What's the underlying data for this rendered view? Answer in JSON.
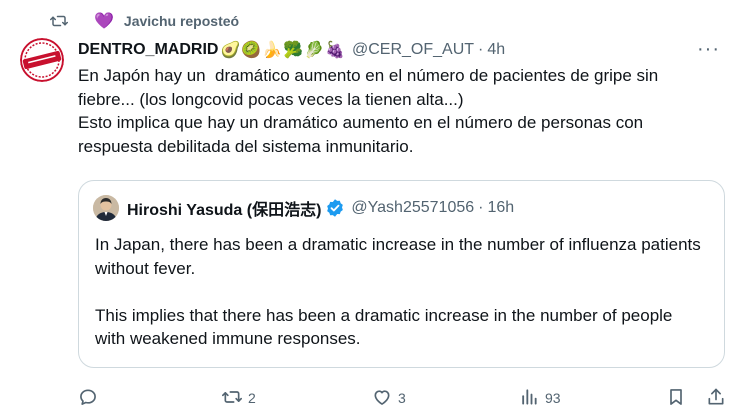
{
  "repost": {
    "text": "Javichu reposteó",
    "icon": "repost-icon",
    "heart_color": "#b58cf0"
  },
  "tweet": {
    "author_name": "DENTRO_MADRID",
    "author_emojis": "🥑🥝🍌🥦🥬🍇",
    "handle": "@CER_OF_AUT",
    "dot": "·",
    "time": "4h",
    "text": "En Japón hay un  dramático aumento en el número de pacientes de gripe sin fiebre... (los longcovid pocas veces la tienen alta...)\nEsto implica que hay un dramático aumento en el número de personas con respuesta debilitada del sistema inmunitario.",
    "more_label": "···"
  },
  "quote": {
    "name": "Hiroshi Yasuda (保田浩志)",
    "handle": "@Yash25571056",
    "dot": "·",
    "time": "16h",
    "verified_color": "#1d9bf0",
    "text": "In Japan, there has been a dramatic increase in the number of influenza patients without fever.\n\nThis implies that there has been a dramatic increase in the number of people with weakened immune responses."
  },
  "actions": {
    "reply_count": "",
    "repost_count": "2",
    "like_count": "3",
    "views_count": "93"
  },
  "colors": {
    "text": "#0f1419",
    "secondary": "#536471",
    "border": "#cfd9de",
    "avatar_red": "#c8102e"
  }
}
